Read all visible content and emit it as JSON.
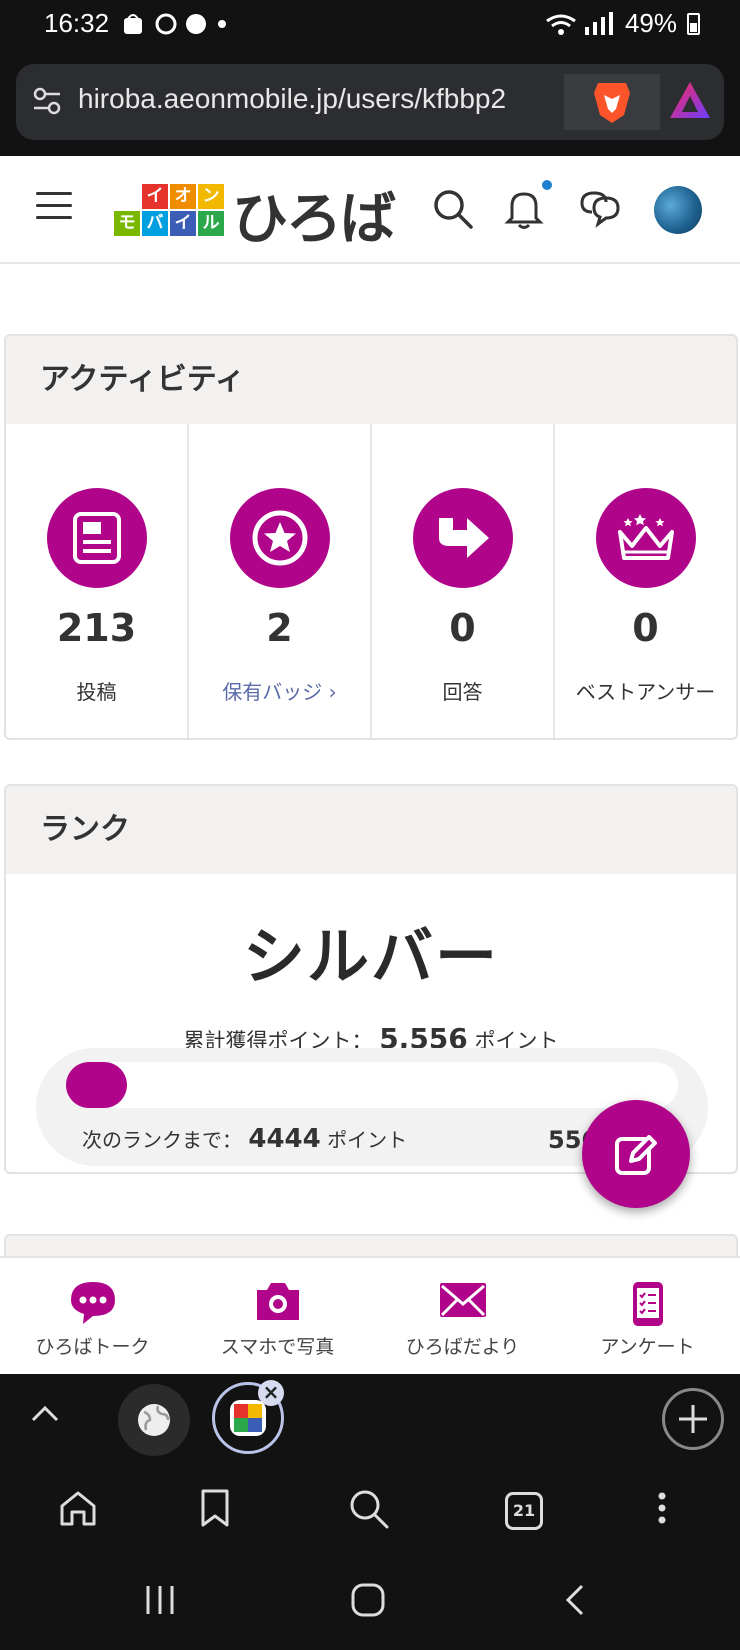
{
  "status_bar": {
    "time": "16:32",
    "battery": "49%",
    "icons": [
      "bag-icon",
      "pinwheel-icon",
      "flower-icon",
      "dot-icon",
      "battery-saver-icon",
      "wifi-icon",
      "signal-icon",
      "battery-icon"
    ]
  },
  "browser": {
    "url": "hiroba.aeonmobile.jp/users/kfbbp2",
    "tab_count": "21"
  },
  "site": {
    "logo_blocks": [
      "イ",
      "オ",
      "ン",
      "モ",
      "バ",
      "イ",
      "ル"
    ],
    "logo_text": "ひろば"
  },
  "activity": {
    "heading": "アクティビティ",
    "stats": [
      {
        "value": "213",
        "label": "投稿"
      },
      {
        "value": "2",
        "label": "保有バッジ ›"
      },
      {
        "value": "0",
        "label": "回答"
      },
      {
        "value": "0",
        "label": "ベストアンサー"
      }
    ]
  },
  "rank": {
    "heading": "ランク",
    "title": "シルバー",
    "total_label": "累計獲得ポイント：",
    "total_value": "5,556",
    "total_unit": "ポイント",
    "next_label": "次のランクまで：",
    "next_value": "4444",
    "next_unit": "ポイント",
    "goal_partial": "556",
    "progress_fraction": 0.1
  },
  "bottom_nav": [
    {
      "label": "ひろばトーク"
    },
    {
      "label": "スマホで写真"
    },
    {
      "label": "ひろばだより"
    },
    {
      "label": "アンケート"
    }
  ],
  "colors": {
    "accent": "#b0058a",
    "link": "#5a6aa8"
  }
}
